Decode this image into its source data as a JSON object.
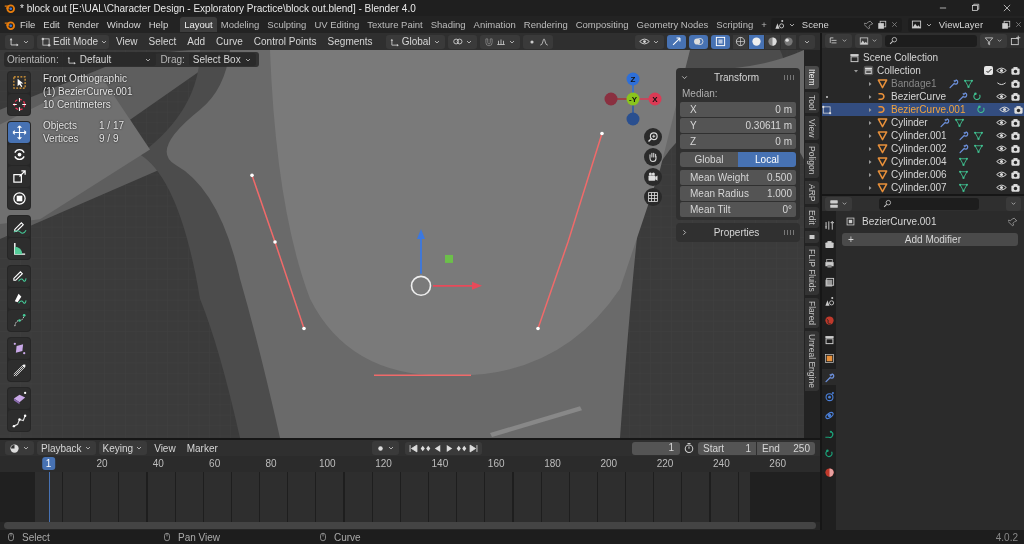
{
  "window": {
    "title": "* block out [E:\\UAL\\Character Design - Exploratory Practice\\block out.blend] - Blender 4.0"
  },
  "menu": [
    "File",
    "Edit",
    "Render",
    "Window",
    "Help"
  ],
  "workspaces": [
    {
      "label": "Layout",
      "selected": true
    },
    {
      "label": "Modeling",
      "selected": false
    },
    {
      "label": "Sculpting",
      "selected": false
    },
    {
      "label": "UV Editing",
      "selected": false
    },
    {
      "label": "Texture Paint",
      "selected": false
    },
    {
      "label": "Shading",
      "selected": false
    },
    {
      "label": "Animation",
      "selected": false
    },
    {
      "label": "Rendering",
      "selected": false
    },
    {
      "label": "Compositing",
      "selected": false
    },
    {
      "label": "Geometry Nodes",
      "selected": false
    },
    {
      "label": "Scripting",
      "selected": false
    }
  ],
  "add_workspace": "+",
  "scene": "Scene",
  "view_layer": "ViewLayer",
  "viewport": {
    "mode": "Edit Mode",
    "menus": [
      "View",
      "Select",
      "Add",
      "Curve",
      "Control Points",
      "Segments"
    ],
    "transform_orientation": "Global",
    "xray": true,
    "shading": [
      {
        "kind": "wireframe",
        "selected": false
      },
      {
        "kind": "solid",
        "selected": true
      },
      {
        "kind": "material",
        "selected": false
      },
      {
        "kind": "rendered",
        "selected": false
      }
    ],
    "orientation_label": "Orientation:",
    "orientation": "Default",
    "drag_label": "Drag:",
    "drag": "Select Box",
    "tool_groups": [
      [
        {
          "kind": "select-box",
          "selected": false
        },
        {
          "kind": "cursor",
          "selected": false
        }
      ],
      [
        {
          "kind": "move",
          "selected": true
        },
        {
          "kind": "rotate",
          "selected": false
        },
        {
          "kind": "scale",
          "selected": false
        },
        {
          "kind": "transform",
          "selected": false
        }
      ],
      [
        {
          "kind": "annotate",
          "selected": false
        },
        {
          "kind": "measure",
          "selected": false
        }
      ],
      [
        {
          "kind": "draw",
          "selected": false
        },
        {
          "kind": "pen",
          "selected": false
        },
        {
          "kind": "extrude",
          "selected": false
        }
      ],
      [
        {
          "kind": "radius",
          "selected": false
        },
        {
          "kind": "tilt",
          "selected": false
        }
      ],
      [
        {
          "kind": "randomize",
          "selected": false
        },
        {
          "kind": "polyline",
          "selected": false
        }
      ]
    ],
    "info": [
      "Front Orthographic",
      "(1) BezierCurve.001",
      "10 Centimeters"
    ],
    "stats": [
      {
        "label": "Objects",
        "value": "1 / 17"
      },
      {
        "label": "Vertices",
        "value": "9 / 9"
      }
    ],
    "axes": [
      {
        "label": "Z",
        "color": "#2e6fd8"
      },
      {
        "label": "-Y",
        "color": "#8ac41c"
      },
      {
        "label": "X",
        "color": "#db3a55"
      }
    ],
    "transform": {
      "title": "Transform",
      "expanded": true,
      "median_label": "Median:",
      "fields": [
        {
          "label": "X",
          "value": "0 m"
        },
        {
          "label": "Y",
          "value": "0.30611 m"
        },
        {
          "label": "Z",
          "value": "0 m"
        }
      ],
      "space": [
        {
          "label": "Global",
          "selected": false
        },
        {
          "label": "Local",
          "selected": true
        }
      ],
      "props": [
        {
          "label": "Mean Weight",
          "value": "0.500"
        },
        {
          "label": "Mean Radius",
          "value": "1.000"
        },
        {
          "label": "Mean Tilt",
          "value": "0°"
        }
      ]
    },
    "properties_panel": {
      "title": "Properties",
      "expanded": false
    },
    "sidebar_tabs": [
      {
        "kind": "text",
        "label": "Item",
        "selected": true
      },
      {
        "kind": "text",
        "label": "Tool",
        "selected": false
      },
      {
        "kind": "text",
        "label": "View",
        "selected": false
      },
      {
        "kind": "text",
        "label": "Poligon",
        "selected": false
      },
      {
        "kind": "text",
        "label": "ARP",
        "selected": false
      },
      {
        "kind": "text",
        "label": "Edit",
        "selected": false
      },
      {
        "kind": "icon",
        "selected": false
      },
      {
        "kind": "text",
        "label": "FLIP Fluids",
        "selected": false
      },
      {
        "kind": "text",
        "label": "Flared",
        "selected": false
      },
      {
        "kind": "text",
        "label": "Unreal Engine",
        "selected": false
      }
    ]
  },
  "outliner": {
    "tree": [
      {
        "label": "Scene Collection",
        "kind": "scene-collection",
        "children": [
          {
            "label": "Collection",
            "kind": "collection",
            "expanded": true,
            "checked": true,
            "children": [
              {
                "label": "Bandage1",
                "kind": "mesh",
                "expanded": false,
                "modifier": true,
                "visible": false,
                "selected": false,
                "in_edit_mode": false,
                "can_edit": false
              },
              {
                "label": "BezierCurve",
                "kind": "curve",
                "expanded": false,
                "modifier": true,
                "visible": true,
                "selected": false,
                "in_edit_mode": false,
                "can_edit": true
              },
              {
                "label": "BezierCurve.001",
                "kind": "curve",
                "expanded": false,
                "modifier": false,
                "visible": true,
                "selected": true,
                "in_edit_mode": true,
                "can_edit": true
              },
              {
                "label": "Cylinder",
                "kind": "mesh",
                "expanded": false,
                "modifier": true,
                "visible": true,
                "selected": false,
                "in_edit_mode": false,
                "can_edit": false
              },
              {
                "label": "Cylinder.001",
                "kind": "mesh",
                "expanded": false,
                "modifier": true,
                "visible": true,
                "selected": false,
                "in_edit_mode": false,
                "can_edit": false
              },
              {
                "label": "Cylinder.002",
                "kind": "mesh",
                "expanded": false,
                "modifier": true,
                "visible": true,
                "selected": false,
                "in_edit_mode": false,
                "can_edit": false
              },
              {
                "label": "Cylinder.004",
                "kind": "mesh",
                "expanded": false,
                "modifier": false,
                "visible": true,
                "selected": false,
                "in_edit_mode": false,
                "can_edit": false
              },
              {
                "label": "Cylinder.006",
                "kind": "mesh",
                "expanded": false,
                "modifier": false,
                "visible": true,
                "selected": false,
                "in_edit_mode": false,
                "can_edit": false
              },
              {
                "label": "Cylinder.007",
                "kind": "mesh",
                "expanded": false,
                "modifier": false,
                "visible": true,
                "selected": false,
                "in_edit_mode": false,
                "can_edit": false
              }
            ]
          }
        ]
      }
    ]
  },
  "properties": {
    "tabs": [
      {
        "kind": "tool",
        "selected": false
      },
      {
        "kind": "render",
        "selected": false
      },
      {
        "kind": "output",
        "selected": false
      },
      {
        "kind": "view-layer",
        "selected": false
      },
      {
        "kind": "scene",
        "selected": false
      },
      {
        "kind": "world",
        "selected": false
      },
      {
        "kind": "collection",
        "selected": false
      },
      {
        "kind": "object",
        "selected": false
      },
      {
        "kind": "modifier",
        "selected": true
      },
      {
        "kind": "particles",
        "selected": false
      },
      {
        "kind": "physics",
        "selected": false
      },
      {
        "kind": "constraints",
        "selected": false
      },
      {
        "kind": "data",
        "selected": false
      },
      {
        "kind": "material",
        "selected": false
      }
    ],
    "object": "BezierCurve.001",
    "add_modifier": "Add Modifier",
    "add_sign": "+"
  },
  "timeline": {
    "menus": [
      {
        "label": "Playback",
        "dropdown": true
      },
      {
        "label": "Keying",
        "dropdown": true
      },
      {
        "label": "View",
        "dropdown": false
      },
      {
        "label": "Marker",
        "dropdown": false
      }
    ],
    "current_frame": "1",
    "start_label": "Start",
    "start": "1",
    "end_label": "End",
    "end": "250",
    "playhead": "1",
    "ticks": [
      "20",
      "40",
      "60",
      "80",
      "100",
      "120",
      "140",
      "160",
      "180",
      "200",
      "220",
      "240",
      "260"
    ]
  },
  "status_bar": {
    "hints": [
      "Select",
      "Pan View",
      "Curve"
    ],
    "version": "4.0.2"
  }
}
